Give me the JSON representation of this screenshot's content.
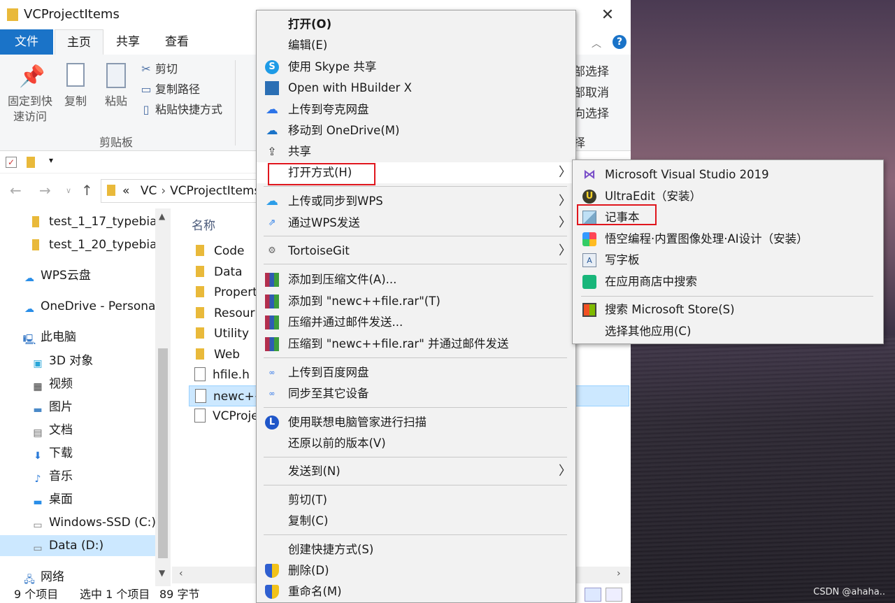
{
  "window": {
    "title": "VCProjectItems",
    "close": "✕"
  },
  "ribbon": {
    "tabs": [
      "文件",
      "主页",
      "共享",
      "查看"
    ],
    "pin_label": "固定到快\n速访问",
    "copy_label": "复制",
    "paste_label": "粘贴",
    "cut_label": "剪切",
    "copy_path_label": "复制路径",
    "paste_shortcut_label": "粘贴快捷方式",
    "clipboard_group": "剪贴板",
    "right_partial": [
      "部选择",
      "部取消",
      "向选择",
      "择"
    ]
  },
  "address": {
    "parts": [
      "«",
      "VC",
      "VCProjectItems"
    ]
  },
  "navpane": {
    "items": [
      "test_1_17_typebian",
      "test_1_20_typebian",
      "WPS云盘",
      "OneDrive - Personal",
      "此电脑",
      "3D 对象",
      "视频",
      "图片",
      "文档",
      "下载",
      "音乐",
      "桌面",
      "Windows-SSD (C:)",
      "Data (D:)",
      "网络"
    ]
  },
  "filelist": {
    "header": "名称",
    "files": [
      "Code",
      "Data",
      "Propert",
      "Resour",
      "Utility",
      "Web",
      "hfile.h",
      "newc++",
      "VCProje"
    ]
  },
  "status": {
    "count": "9 个项目",
    "selected": "选中 1 个项目",
    "size": "89 字节"
  },
  "context_menu": {
    "items": [
      "打开(O)",
      "编辑(E)",
      "使用 Skype 共享",
      "Open with HBuilder X",
      "上传到夸克网盘",
      "移动到 OneDrive(M)",
      "共享",
      "打开方式(H)",
      "上传或同步到WPS",
      "通过WPS发送",
      "TortoiseGit",
      "添加到压缩文件(A)...",
      "添加到 \"newc++file.rar\"(T)",
      "压缩并通过邮件发送...",
      "压缩到 \"newc++file.rar\" 并通过邮件发送",
      "上传到百度网盘",
      "同步至其它设备",
      "使用联想电脑管家进行扫描",
      "还原以前的版本(V)",
      "发送到(N)",
      "剪切(T)",
      "复制(C)",
      "创建快捷方式(S)",
      "删除(D)",
      "重命名(M)"
    ],
    "arrow": "〉"
  },
  "submenu": {
    "items": [
      "Microsoft Visual Studio 2019",
      "UltraEdit（安装）",
      "记事本",
      "悟空编程·内置图像处理·AI设计（安装）",
      "写字板",
      "在应用商店中搜索",
      "搜索 Microsoft Store(S)",
      "选择其他应用(C)"
    ]
  },
  "watermark": "CSDN @ahaha..",
  "colors": {
    "highlight_box": "#e0161d",
    "selection": "#cce8ff",
    "file_tab": "#1a73c8"
  }
}
